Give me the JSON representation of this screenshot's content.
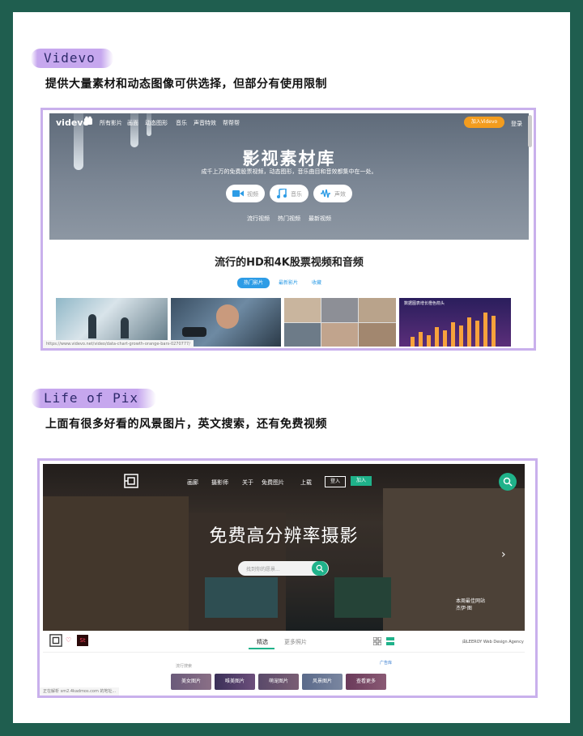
{
  "sections": [
    {
      "title": "Videvo",
      "subtitle": "提供大量素材和动态图像可供选择，但部分有使用限制"
    },
    {
      "title": "Life of Pix",
      "subtitle": "上面有很多好看的风景图片，英文搜索，还有免费视频"
    }
  ],
  "videvo": {
    "logo": "videvo",
    "nav": [
      "所有影片",
      "画面",
      "动态图形",
      "音乐",
      "声音特效",
      "帮帮帮"
    ],
    "join_button": "加入Videvo",
    "login": "登录",
    "hero_title": "影视素材库",
    "hero_lead": "成千上万的免费股票视频，动态图形，音乐曲目和音效都集中在一处。",
    "media_pills": [
      {
        "icon": "video-camera-icon",
        "label": "视频"
      },
      {
        "icon": "music-note-icon",
        "label": "音乐"
      },
      {
        "icon": "sound-wave-icon",
        "label": "声效"
      }
    ],
    "hero_links": [
      "流行视频",
      "热门视频",
      "最新视频"
    ],
    "section_heading": "流行的HD和4K股票视频和音频",
    "tabs": [
      "热门影片",
      "最新影片",
      "收藏"
    ],
    "thumb_caption": "数据图表增长橙色箭头",
    "status_url": "https://www.videvo.net/video/data-chart-growth-orange-bars-0270777/"
  },
  "lifeofpix": {
    "nav": [
      "画廊",
      "摄影师",
      "关于",
      "免费图片",
      "上载"
    ],
    "signin": "登入",
    "join": "加入",
    "hero_title": "免费高分辨率摄影",
    "search_placeholder": "找到你的愿景...",
    "award_text": "本周最佳网站",
    "award_sub": "杰伊·图",
    "sub_logo_badge": "St",
    "tabs": [
      "精选",
      "更多照片"
    ],
    "agency": "由LEEROY Web Design Agency",
    "filter_label": "流行搜索",
    "filter_right": "广告库",
    "categories": [
      "美女图片",
      "唯美图片",
      "萌宠图片",
      "风景图片",
      "查看更多"
    ],
    "status_text": "正在解析 sm2.4kadmos.com 的地址..."
  },
  "colors": {
    "background": "#1f5e4f",
    "card": "#ffffff",
    "title_highlight": "#c6a7ee",
    "frame": "#c9b0ec",
    "videvo_orange": "#f39c1e",
    "videvo_blue": "#2d9ce6",
    "lifeofpix_green": "#1fb28a"
  }
}
